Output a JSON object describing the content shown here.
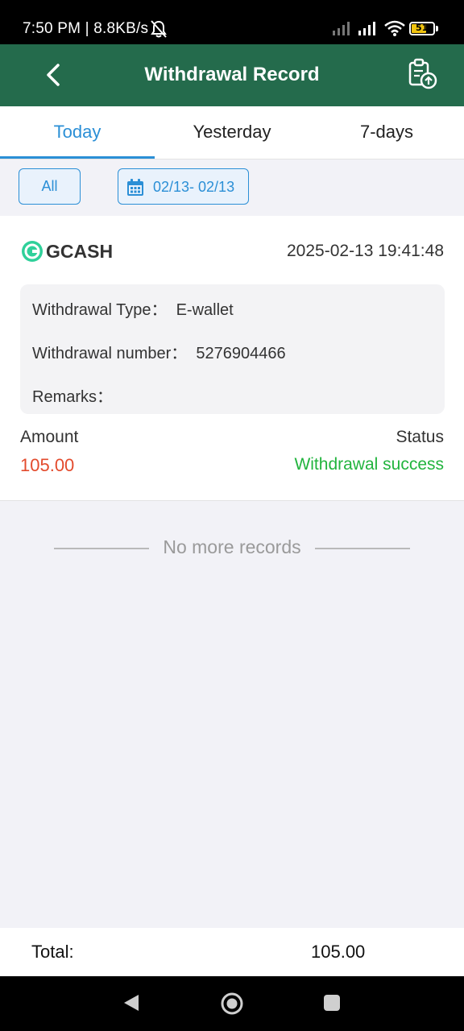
{
  "status_bar": {
    "time": "7:50 PM | 8.8KB/s",
    "battery": "51",
    "icons": [
      "bell-off-icon",
      "signal-icon",
      "signal-icon",
      "wifi-icon",
      "battery-icon"
    ]
  },
  "header": {
    "title": "Withdrawal Record",
    "back_icon": "chevron-left-icon",
    "action_icon": "clipboard-upload-icon"
  },
  "tabs": [
    {
      "label": "Today",
      "active": true
    },
    {
      "label": "Yesterday",
      "active": false
    },
    {
      "label": "7-days",
      "active": false
    }
  ],
  "filters": {
    "all_label": "All",
    "date_range": "02/13- 02/13",
    "date_icon": "calendar-icon"
  },
  "record": {
    "brand": "GCASH",
    "brand_icon": "gcash-logo-icon",
    "datetime": "2025-02-13 19:41:48",
    "type_line": "Withdrawal Type：  E-wallet",
    "number_line": "Withdrawal number：  5276904466",
    "remarks_line": "Remarks：",
    "amount_label": "Amount",
    "amount_value": "105.00",
    "status_label": "Status",
    "status_value": "Withdrawal success"
  },
  "footer_note": "No more records",
  "total": {
    "label": "Total:",
    "value": "105.00"
  },
  "colors": {
    "header": "#246b4c",
    "accent": "#2b8fd6",
    "amount": "#e34b2d",
    "success": "#22b43e"
  }
}
